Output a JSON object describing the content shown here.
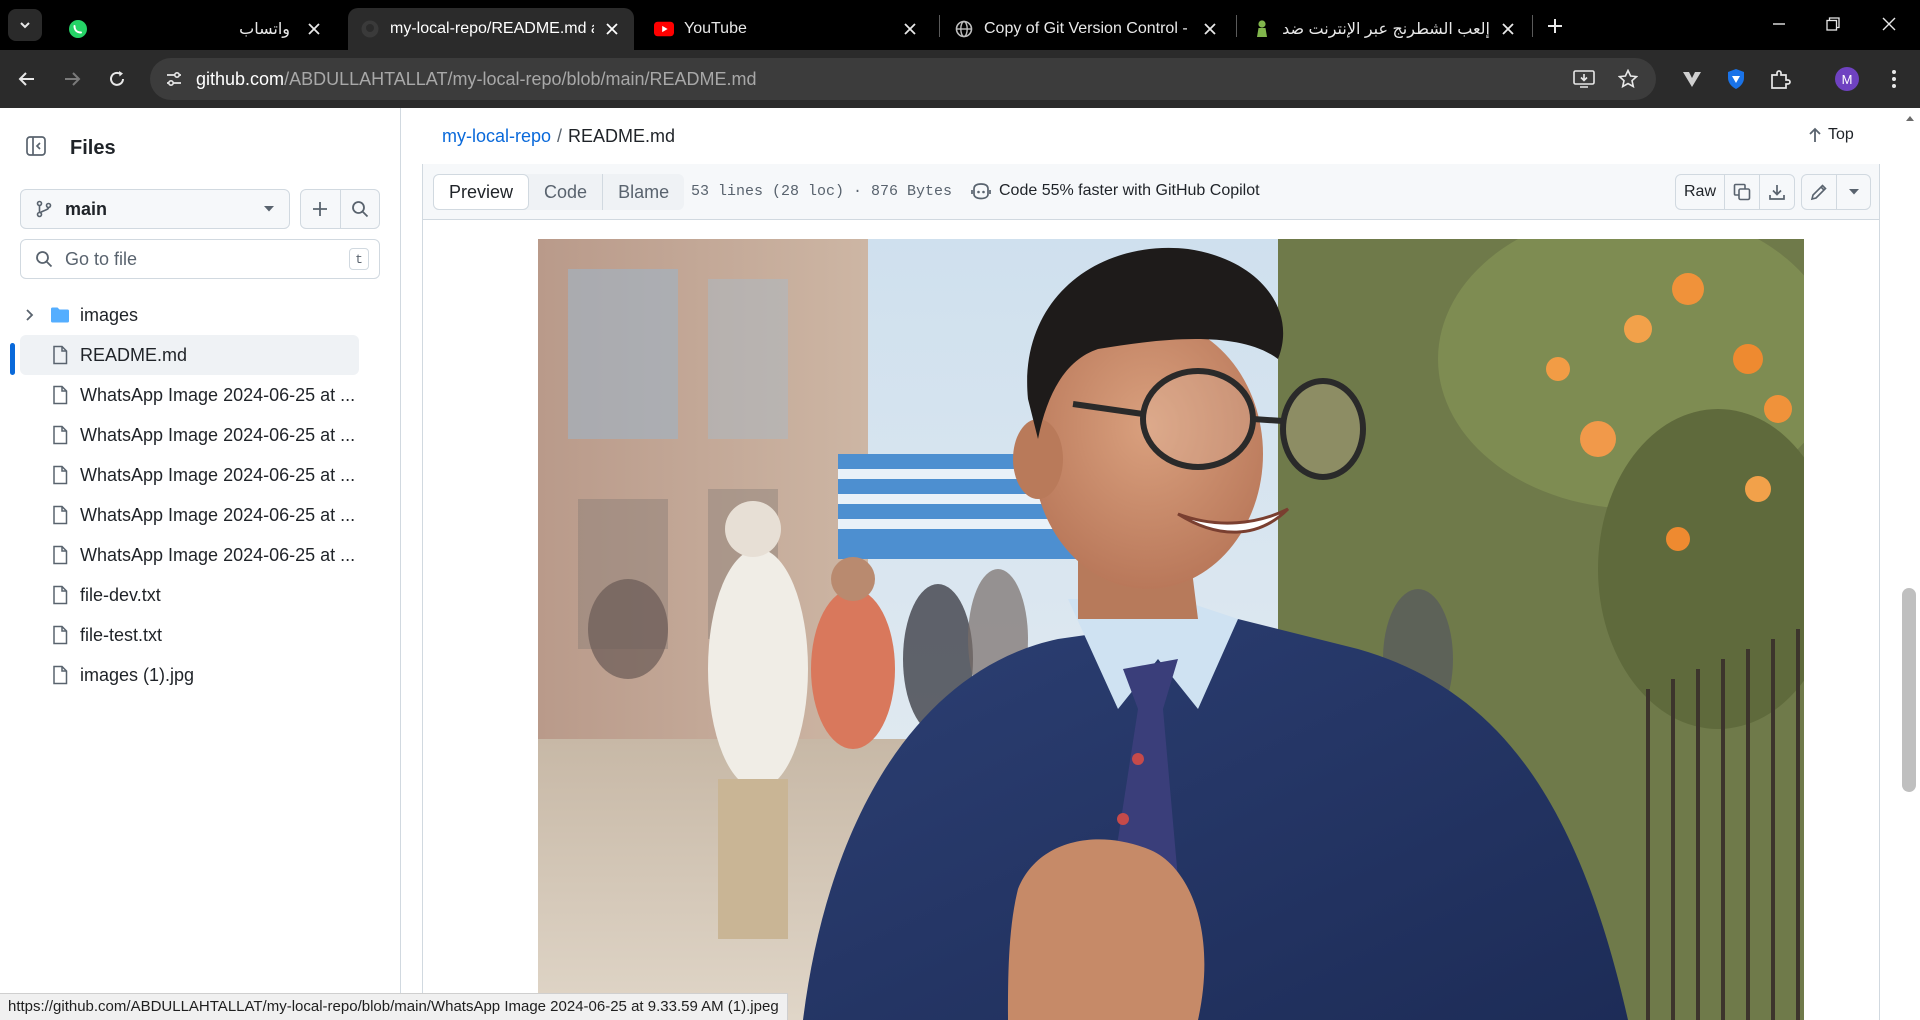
{
  "browser": {
    "tabs": [
      {
        "title": "واتساب",
        "icon": "whatsapp-icon",
        "active": false
      },
      {
        "title": "my-local-repo/README.md at m",
        "icon": "github-icon",
        "active": true
      },
      {
        "title": "YouTube",
        "icon": "youtube-icon",
        "active": false
      },
      {
        "title": "Copy of Git Version Control - D",
        "icon": "globe-icon",
        "active": false
      },
      {
        "title": "إلعب الشطرنج عبر الإنترنت ضد كـ",
        "icon": "chess-pawn-icon",
        "active": false
      }
    ],
    "url_host": "github.com",
    "url_path": "/ABDULLAHTALLAT/my-local-repo/blob/main/README.md",
    "profile_initial": "M"
  },
  "sidebar": {
    "title": "Files",
    "branch": "main",
    "search_placeholder": "Go to file",
    "search_shortcut": "t",
    "items": [
      {
        "name": "images",
        "type": "folder"
      },
      {
        "name": "README.md",
        "type": "file",
        "selected": true
      },
      {
        "name": "WhatsApp Image 2024-06-25 at ...",
        "type": "file"
      },
      {
        "name": "WhatsApp Image 2024-06-25 at ...",
        "type": "file"
      },
      {
        "name": "WhatsApp Image 2024-06-25 at ...",
        "type": "file"
      },
      {
        "name": "WhatsApp Image 2024-06-25 at ...",
        "type": "file"
      },
      {
        "name": "WhatsApp Image 2024-06-25 at ...",
        "type": "file"
      },
      {
        "name": "file-dev.txt",
        "type": "file"
      },
      {
        "name": "file-test.txt",
        "type": "file"
      },
      {
        "name": "images (1).jpg",
        "type": "file"
      }
    ]
  },
  "main": {
    "breadcrumb_repo": "my-local-repo",
    "breadcrumb_sep": "/",
    "breadcrumb_file": "README.md",
    "top_label": "Top",
    "tabs": {
      "preview": "Preview",
      "code": "Code",
      "blame": "Blame"
    },
    "file_meta": "53 lines (28 loc) · 876 Bytes",
    "copilot_text": "Code 55% faster with GitHub Copilot",
    "raw_label": "Raw"
  },
  "status_url": "https://github.com/ABDULLAHTALLAT/my-local-repo/blob/main/WhatsApp Image 2024-06-25 at 9.33.59 AM (1).jpeg",
  "colors": {
    "link": "#0969da",
    "accent_bar": "#0969da",
    "folder": "#54aeff",
    "youtube": "#ff0000",
    "whatsapp": "#25d366"
  }
}
